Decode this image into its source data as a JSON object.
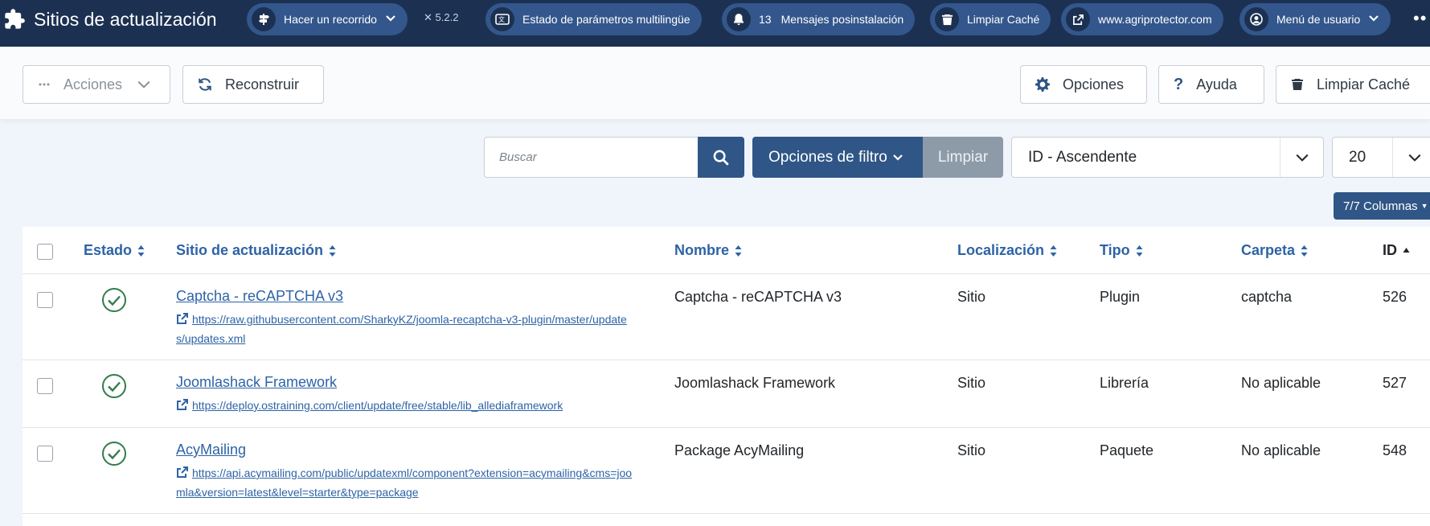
{
  "header": {
    "title": "Sitios de actualización",
    "tour_label": "Hacer un recorrido",
    "version": "5.2.2",
    "multilang_label": "Estado de parámetros multilingüe",
    "postinstall_count": "13",
    "postinstall_label": "Mensajes posinstalación",
    "clear_cache_label": "Limpiar Caché",
    "site_link_label": "www.agriprotector.com",
    "user_menu_label": "Menú de usuario",
    "bg_color": "#1c3152",
    "pill_color": "#33578c"
  },
  "toolbar": {
    "actions_label": "Acciones",
    "rebuild_label": "Reconstruir",
    "options_label": "Opciones",
    "help_label": "Ayuda",
    "clear_cache_label": "Limpiar Caché"
  },
  "filters": {
    "search_placeholder": "Buscar",
    "filter_options_label": "Opciones de filtro",
    "clear_label": "Limpiar",
    "ordering_value": "ID - Ascendente",
    "limit_value": "20",
    "columns_label": "7/7 Columnas"
  },
  "table": {
    "columns": {
      "estado": "Estado",
      "sitio": "Sitio de actualización",
      "nombre": "Nombre",
      "localizacion": "Localización",
      "tipo": "Tipo",
      "carpeta": "Carpeta",
      "id": "ID"
    },
    "rows": [
      {
        "site_name": "Captcha - reCAPTCHA v3",
        "url": "https://raw.githubusercontent.com/SharkyKZ/joomla-recaptcha-v3-plugin/master/updates/updates.xml",
        "name": "Captcha - reCAPTCHA v3",
        "location": "Sitio",
        "type": "Plugin",
        "folder": "captcha",
        "id": "526",
        "status": "enabled"
      },
      {
        "site_name": "Joomlashack Framework",
        "url": "https://deploy.ostraining.com/client/update/free/stable/lib_allediaframework",
        "name": "Joomlashack Framework",
        "location": "Sitio",
        "type": "Librería",
        "folder": "No aplicable",
        "id": "527",
        "status": "enabled"
      },
      {
        "site_name": "AcyMailing",
        "url": "https://api.acymailing.com/public/updatexml/component?extension=acymailing&cms=joomla&version=latest&level=starter&type=package",
        "name": "Package AcyMailing",
        "location": "Sitio",
        "type": "Paquete",
        "folder": "No aplicable",
        "id": "548",
        "status": "enabled"
      }
    ]
  },
  "colors": {
    "primary": "#2f5686",
    "link": "#2d63a6",
    "success": "#2f7d4a"
  }
}
